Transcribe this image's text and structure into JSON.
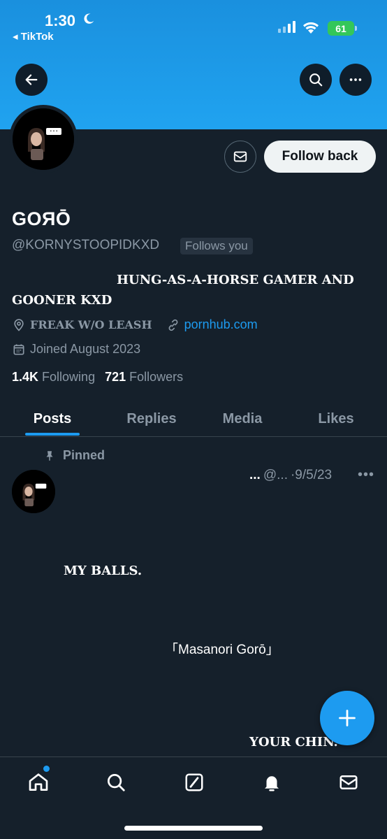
{
  "status_bar": {
    "time": "1:30",
    "back_app": "◂ TikTok",
    "battery": "61"
  },
  "profile": {
    "display_name": "GOЯŌ",
    "handle": "@KORNYSTOOPIDKXD",
    "follows_you": "Follows you",
    "follow_back_label": "Follow back",
    "bio_line1": "HUNG-AS-A-HORSE GAMER AND",
    "bio_line2": "GOONER KXD",
    "location": "FREAK W/O LEASH",
    "website": "pornhub.com",
    "joined": "Joined August 2023",
    "following_count": "1.4K",
    "following_label": "Following",
    "followers_count": "721",
    "followers_label": "Followers"
  },
  "tabs": [
    {
      "label": "Posts"
    },
    {
      "label": "Replies"
    },
    {
      "label": "Media"
    },
    {
      "label": "Likes"
    }
  ],
  "pinned_post": {
    "pinned_label": "Pinned",
    "author_name": "...",
    "author_handle": "@...",
    "date": "·9/5/23",
    "more": "•••",
    "line1": "MY BALLS.",
    "line2": "「Masanori Gorō」",
    "line3": "YOUR CHIN."
  },
  "colors": {
    "background": "#15202b",
    "accent": "#1d9bf0",
    "banner": "#1a90de",
    "secondary_text": "#8b98a5"
  },
  "icons": {
    "header": [
      "back-arrow-icon",
      "search-icon",
      "more-icon"
    ],
    "nav": [
      "home-icon",
      "search-icon",
      "compose-icon",
      "bell-icon",
      "mail-icon"
    ]
  }
}
